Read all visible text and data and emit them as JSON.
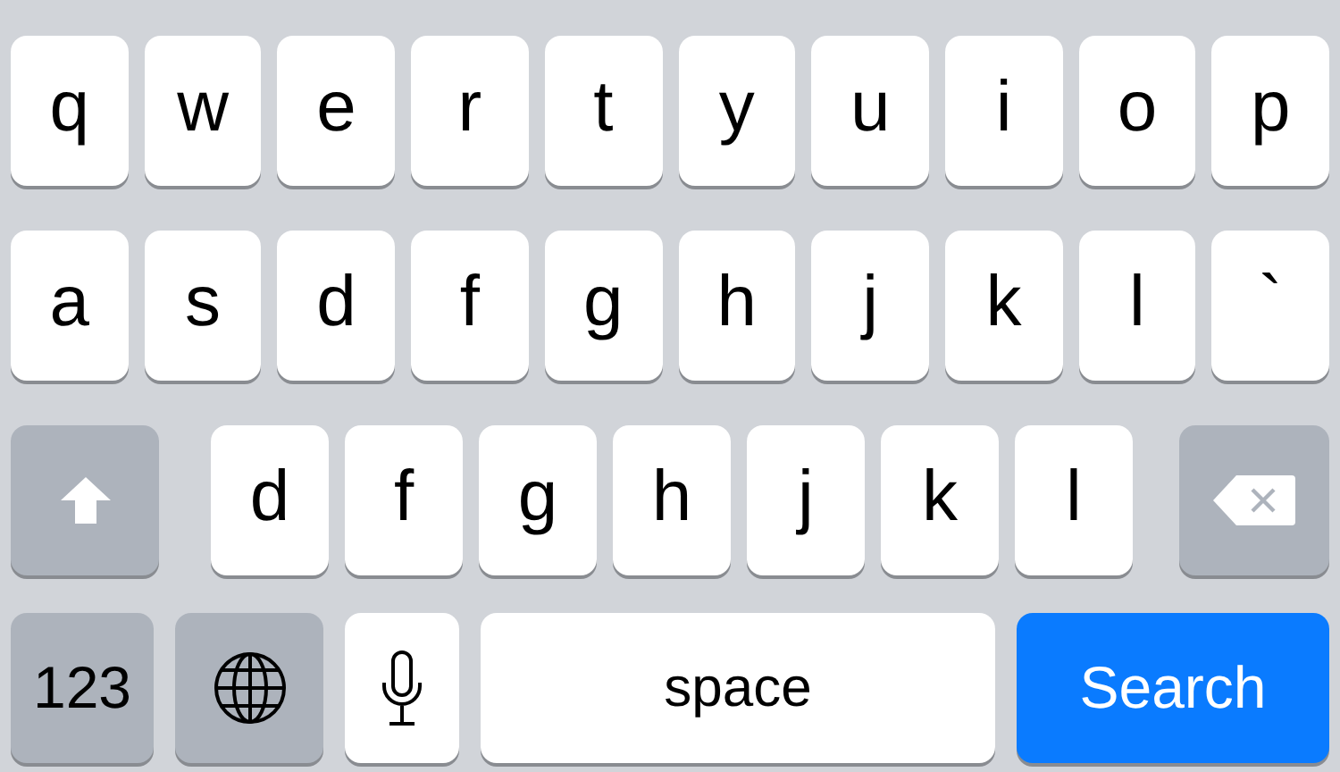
{
  "keyboard": {
    "rows": [
      {
        "keys": [
          {
            "kind": "letter",
            "label": "q"
          },
          {
            "kind": "letter",
            "label": "w"
          },
          {
            "kind": "letter",
            "label": "e"
          },
          {
            "kind": "letter",
            "label": "r"
          },
          {
            "kind": "letter",
            "label": "t"
          },
          {
            "kind": "letter",
            "label": "y"
          },
          {
            "kind": "letter",
            "label": "u"
          },
          {
            "kind": "letter",
            "label": "i"
          },
          {
            "kind": "letter",
            "label": "o"
          },
          {
            "kind": "letter",
            "label": "p"
          }
        ]
      },
      {
        "keys": [
          {
            "kind": "letter",
            "label": "a"
          },
          {
            "kind": "letter",
            "label": "s"
          },
          {
            "kind": "letter",
            "label": "d"
          },
          {
            "kind": "letter",
            "label": "f"
          },
          {
            "kind": "letter",
            "label": "g"
          },
          {
            "kind": "letter",
            "label": "h"
          },
          {
            "kind": "letter",
            "label": "j"
          },
          {
            "kind": "letter",
            "label": "k"
          },
          {
            "kind": "letter",
            "label": "l"
          },
          {
            "kind": "letter",
            "label": "`"
          }
        ]
      },
      {
        "keys": [
          {
            "kind": "shift"
          },
          {
            "kind": "letter",
            "label": "d"
          },
          {
            "kind": "letter",
            "label": "f"
          },
          {
            "kind": "letter",
            "label": "g"
          },
          {
            "kind": "letter",
            "label": "h"
          },
          {
            "kind": "letter",
            "label": "j"
          },
          {
            "kind": "letter",
            "label": "k"
          },
          {
            "kind": "letter",
            "label": "l"
          },
          {
            "kind": "delete"
          }
        ]
      },
      {
        "keys": [
          {
            "kind": "numbers",
            "label": "123"
          },
          {
            "kind": "globe"
          },
          {
            "kind": "mic"
          },
          {
            "kind": "space",
            "label": "space"
          },
          {
            "kind": "action",
            "label": "Search"
          }
        ]
      }
    ]
  }
}
